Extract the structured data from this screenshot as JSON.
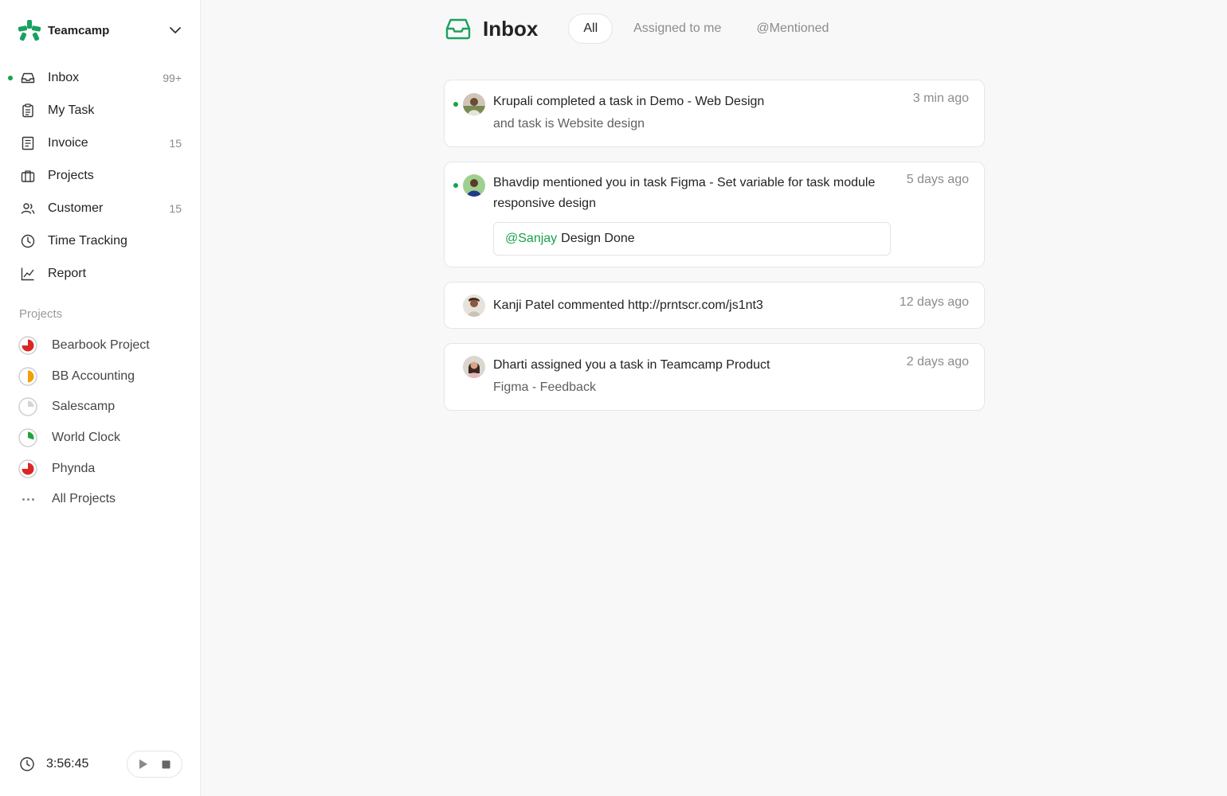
{
  "workspace": {
    "name": "Teamcamp"
  },
  "nav": [
    {
      "label": "Inbox",
      "count": "99+",
      "icon": "inbox-icon",
      "unread": true
    },
    {
      "label": "My Task",
      "count": "",
      "icon": "clipboard-icon"
    },
    {
      "label": "Invoice",
      "count": "15",
      "icon": "invoice-icon"
    },
    {
      "label": "Projects",
      "count": "",
      "icon": "briefcase-icon"
    },
    {
      "label": "Customer",
      "count": "15",
      "icon": "users-icon"
    },
    {
      "label": "Time Tracking",
      "count": "",
      "icon": "clock-icon"
    },
    {
      "label": "Report",
      "count": "",
      "icon": "chart-icon"
    }
  ],
  "projects": {
    "heading": "Projects",
    "items": [
      {
        "label": "Bearbook Project",
        "progress": 0.75,
        "color": "#dc2626"
      },
      {
        "label": "BB Accounting",
        "progress": 0.5,
        "color": "#f59e0b"
      },
      {
        "label": "Salescamp",
        "progress": 0.25,
        "color": "#d1d5db"
      },
      {
        "label": "World Clock",
        "progress": 0.3,
        "color": "#22a33a"
      },
      {
        "label": "Phynda",
        "progress": 0.75,
        "color": "#dc2626"
      }
    ],
    "all_label": "All Projects"
  },
  "timer": {
    "time": "3:56:45"
  },
  "inbox": {
    "title": "Inbox",
    "tabs": [
      {
        "label": "All",
        "active": true
      },
      {
        "label": "Assigned to me",
        "active": false
      },
      {
        "label": "@Mentioned",
        "active": false
      }
    ]
  },
  "notifications": [
    {
      "main": "Krupali completed a task in Demo - Web Design",
      "sub": "and task is Website design",
      "time": "3 min ago",
      "unread": true
    },
    {
      "main": "Bhavdip mentioned you in task Figma - Set variable for task module responsive design",
      "quote_mention": "@Sanjay",
      "quote_text": "Design Done",
      "time": "5 days ago",
      "unread": true
    },
    {
      "main": "Kanji Patel commented http://prntscr.com/js1nt3",
      "time": "12 days ago",
      "unread": false
    },
    {
      "main": "Dharti assigned you a task in Teamcamp Product",
      "sub": "Figma - Feedback",
      "time": "2 days ago",
      "unread": false
    }
  ],
  "colors": {
    "accent": "#16a34a",
    "brand": "#1aa15f"
  }
}
